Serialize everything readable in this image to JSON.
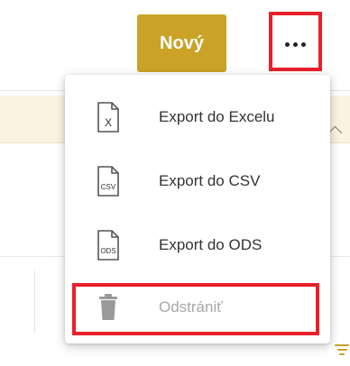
{
  "toolbar": {
    "new_label": "Nový",
    "more_icon": "more-horizontal-icon"
  },
  "menu": {
    "items": [
      {
        "label": "Export do Excelu",
        "icon": "excel-file-icon",
        "icon_text": "X",
        "enabled": true
      },
      {
        "label": "Export do CSV",
        "icon": "csv-file-icon",
        "icon_text": "CSV",
        "enabled": true
      },
      {
        "label": "Export do ODS",
        "icon": "ods-file-icon",
        "icon_text": "ODS",
        "enabled": true
      },
      {
        "label": "Odstrániť",
        "icon": "trash-icon",
        "enabled": false
      }
    ]
  },
  "colors": {
    "accent": "#c9a227",
    "highlight": "#e8202a",
    "band": "#fbf3df",
    "disabled_text": "#a8a8a8"
  }
}
